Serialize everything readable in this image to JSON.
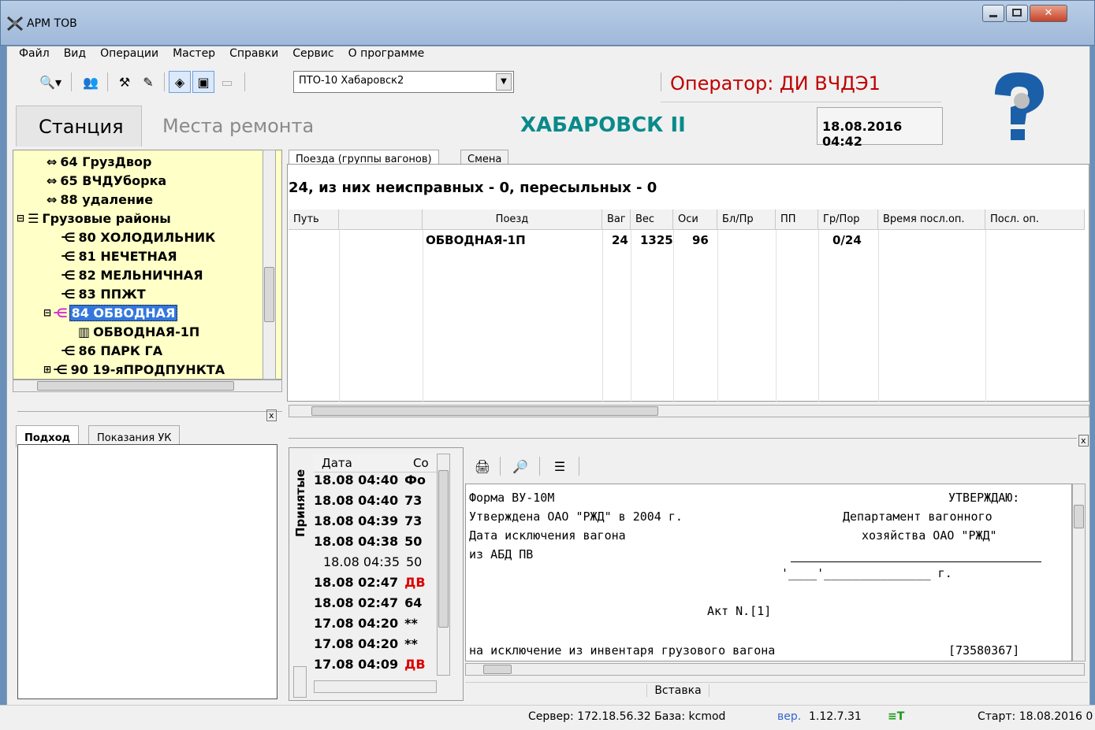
{
  "window": {
    "title": "АРМ ТОВ"
  },
  "menu": [
    "Файл",
    "Вид",
    "Операции",
    "Мастер",
    "Справки",
    "Сервис",
    "О программе"
  ],
  "toolbar": {
    "combo_value": "ПТО-10 Хабаровск2"
  },
  "operator": "Оператор: ДИ ВЧДЭ1",
  "tabs_top": {
    "station": "Станция",
    "repair": "Места ремонта"
  },
  "station_name": "ХАБАРОВСК II",
  "datetime": "18.08.2016 04:42",
  "tree": [
    {
      "label": "64 ГрузДвор",
      "icon": "track-icon"
    },
    {
      "label": "65 ВЧДУборка",
      "icon": "track-icon"
    },
    {
      "label": "88 удаление",
      "icon": "track-icon"
    },
    {
      "label": "Грузовые районы",
      "icon": "region-icon"
    },
    {
      "label": "80 ХОЛОДИЛЬНИК",
      "icon": "switch-icon"
    },
    {
      "label": "81 НЕЧЕТНАЯ",
      "icon": "switch-icon"
    },
    {
      "label": "82 МЕЛЬНИЧНАЯ",
      "icon": "switch-icon"
    },
    {
      "label": "83 ППЖТ",
      "icon": "switch-icon"
    },
    {
      "label": "84 ОБВОДНАЯ",
      "icon": "switch-icon",
      "selected": true
    },
    {
      "label": "ОБВОДНАЯ-1П",
      "icon": "train-icon"
    },
    {
      "label": "86 ПАРК ГА",
      "icon": "switch-icon"
    },
    {
      "label": "90 19-яПРОДПУНКТА",
      "icon": "switch-icon"
    }
  ],
  "left_tabs": {
    "approach": "Подход",
    "uk": "Показания УК"
  },
  "main_tabs": {
    "trains": "Поезда (группы вагонов)",
    "shift": "Смена"
  },
  "summary": "24, из них неисправных - 0, пересыльных - 0",
  "grid": {
    "columns": [
      "Путь",
      "Поезд",
      "Ваг",
      "Вес",
      "Оси",
      "Бл/Пр",
      "ПП",
      "Гр/Пор",
      "Время посл.оп.",
      "Посл. оп."
    ],
    "rows": [
      {
        "train": "ОБВОДНАЯ-1П",
        "cars": "24",
        "weight": "1325",
        "axles": "96",
        "gr": "0/24"
      }
    ]
  },
  "accepted_label": "Принятые",
  "list_head": {
    "date": "Дата",
    "c": "Со"
  },
  "list": [
    {
      "date": "18.08 04:40",
      "code": "Фо",
      "bold": true,
      "red": false
    },
    {
      "date": "18.08 04:40",
      "code": "73",
      "bold": true,
      "red": false
    },
    {
      "date": "18.08 04:39",
      "code": "73",
      "bold": true,
      "red": false
    },
    {
      "date": "18.08 04:38",
      "code": "50",
      "bold": true,
      "red": false
    },
    {
      "date": "18.08 04:35",
      "code": "50",
      "bold": false,
      "red": false
    },
    {
      "date": "18.08 02:47",
      "code": "ДВ",
      "bold": true,
      "red": true
    },
    {
      "date": "18.08 02:47",
      "code": "64",
      "bold": true,
      "red": false
    },
    {
      "date": "17.08 04:20",
      "code": "**",
      "bold": true,
      "red": false
    },
    {
      "date": "17.08 04:20",
      "code": "**",
      "bold": true,
      "red": false
    },
    {
      "date": "17.08 04:09",
      "code": "ДВ",
      "bold": true,
      "red": true
    }
  ],
  "doc": {
    "l1a": "Форма ВУ-10М",
    "l1b": "УТВЕРЖДАЮ:",
    "l2a": "Утверждена ОАО \"РЖД\" в 2004 г.",
    "l2b": "Департамент вагонного",
    "l3a": "Дата исключения вагона",
    "l3b": "хозяйства ОАО \"РЖД\"",
    "l4a": "из АБД ПВ",
    "l5b": "'____'_______________ г.",
    "act": "Акт N.[1]",
    "l7a": "на исключение из инвентаря грузового вагона",
    "l7b": "[73580367]"
  },
  "insert_label": "Вставка",
  "status": {
    "server": "Сервер: 172.18.56.32 База: kcmod",
    "version_prefix": "вер.",
    "version": "1.12.7.31",
    "start": "Старт: 18.08.2016 0"
  },
  "colors": {
    "operator": "#c00000",
    "station": "#0a8a8a",
    "tree_bg": "#ffffc8",
    "selected": "#3377dd",
    "red_text": "#dd0000"
  }
}
